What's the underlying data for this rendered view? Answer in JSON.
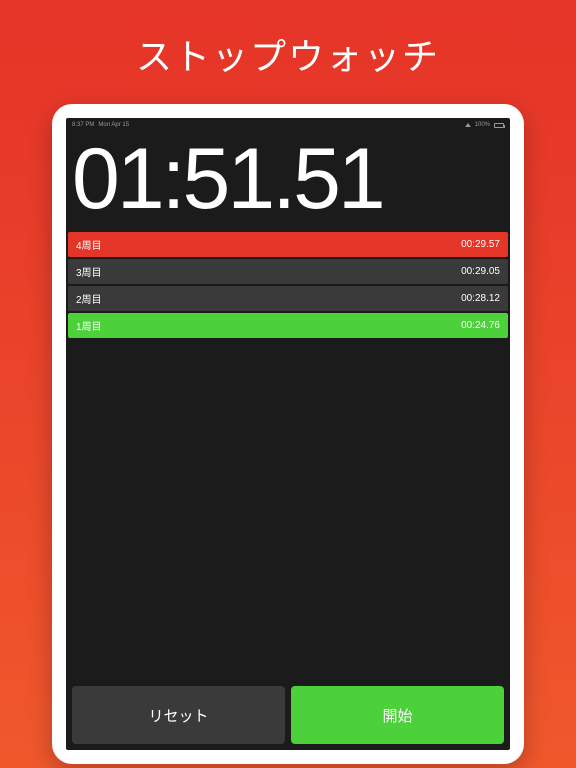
{
  "marketing_title": "ストップウォッチ",
  "status_bar": {
    "time": "8:37 PM",
    "date": "Mon Apr 15",
    "battery": "100%"
  },
  "stopwatch": {
    "main_time": "01:51.51"
  },
  "laps": [
    {
      "label": "4周目",
      "time": "00:29.57",
      "style": "lap-red"
    },
    {
      "label": "3周目",
      "time": "00:29.05",
      "style": "lap-gray"
    },
    {
      "label": "2周目",
      "time": "00:28.12",
      "style": "lap-gray"
    },
    {
      "label": "1周目",
      "time": "00:24.76",
      "style": "lap-green"
    }
  ],
  "buttons": {
    "reset": "リセット",
    "start": "開始"
  }
}
